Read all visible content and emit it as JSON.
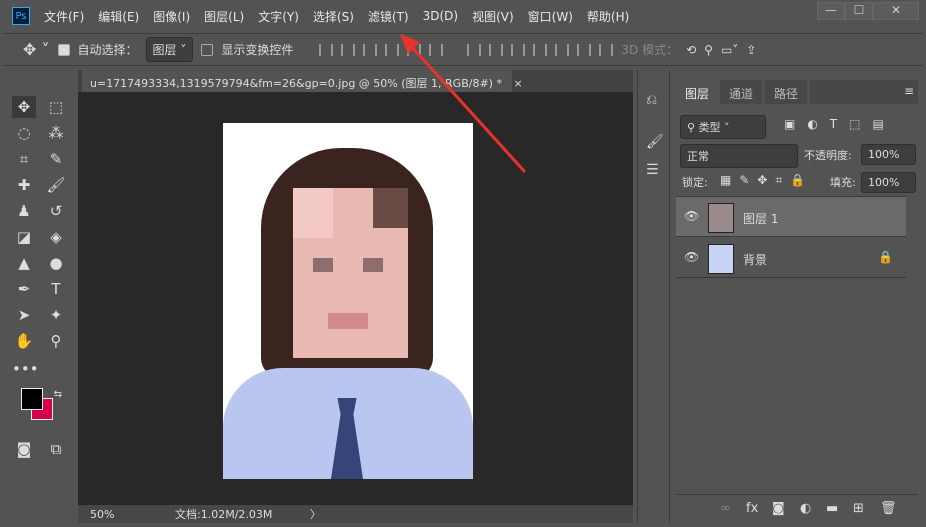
{
  "app": {
    "logo": "Ps",
    "menus": [
      "文件(F)",
      "编辑(E)",
      "图像(I)",
      "图层(L)",
      "文字(Y)",
      "选择(S)",
      "滤镜(T)",
      "3D(D)",
      "视图(V)",
      "窗口(W)",
      "帮助(H)"
    ],
    "window_buttons": [
      "—",
      "☐",
      "✕"
    ]
  },
  "options": {
    "auto_select_label": "自动选择：",
    "auto_select_checked": true,
    "auto_select_target": "图层",
    "show_transform_label": "显示变换控件",
    "show_transform_checked": false,
    "mode_3d_label": "3D 模式："
  },
  "document": {
    "tab_title": "u=1717493334,1319579794&fm=26&gp=0.jpg @ 50% (图层 1, RGB/8#) *",
    "close": "×",
    "zoom": "50%",
    "doc_size": "文档:1.02M/2.03M",
    "status_arrow": "〉"
  },
  "layers_panel": {
    "tabs": [
      "图层",
      "通道",
      "路径"
    ],
    "active_tab": "图层",
    "filter_kind": "类型",
    "blend_mode": "正常",
    "opacity_label": "不透明度:",
    "opacity": "100%",
    "lock_label": "锁定:",
    "fill_label": "填充:",
    "fill": "100%",
    "layers": [
      {
        "name": "图层 1",
        "selected": true,
        "locked": false
      },
      {
        "name": "背景",
        "selected": false,
        "locked": true
      }
    ]
  },
  "colors": {
    "foreground": "#000000",
    "background": "#d6004f",
    "arrow": "#e8332a"
  }
}
